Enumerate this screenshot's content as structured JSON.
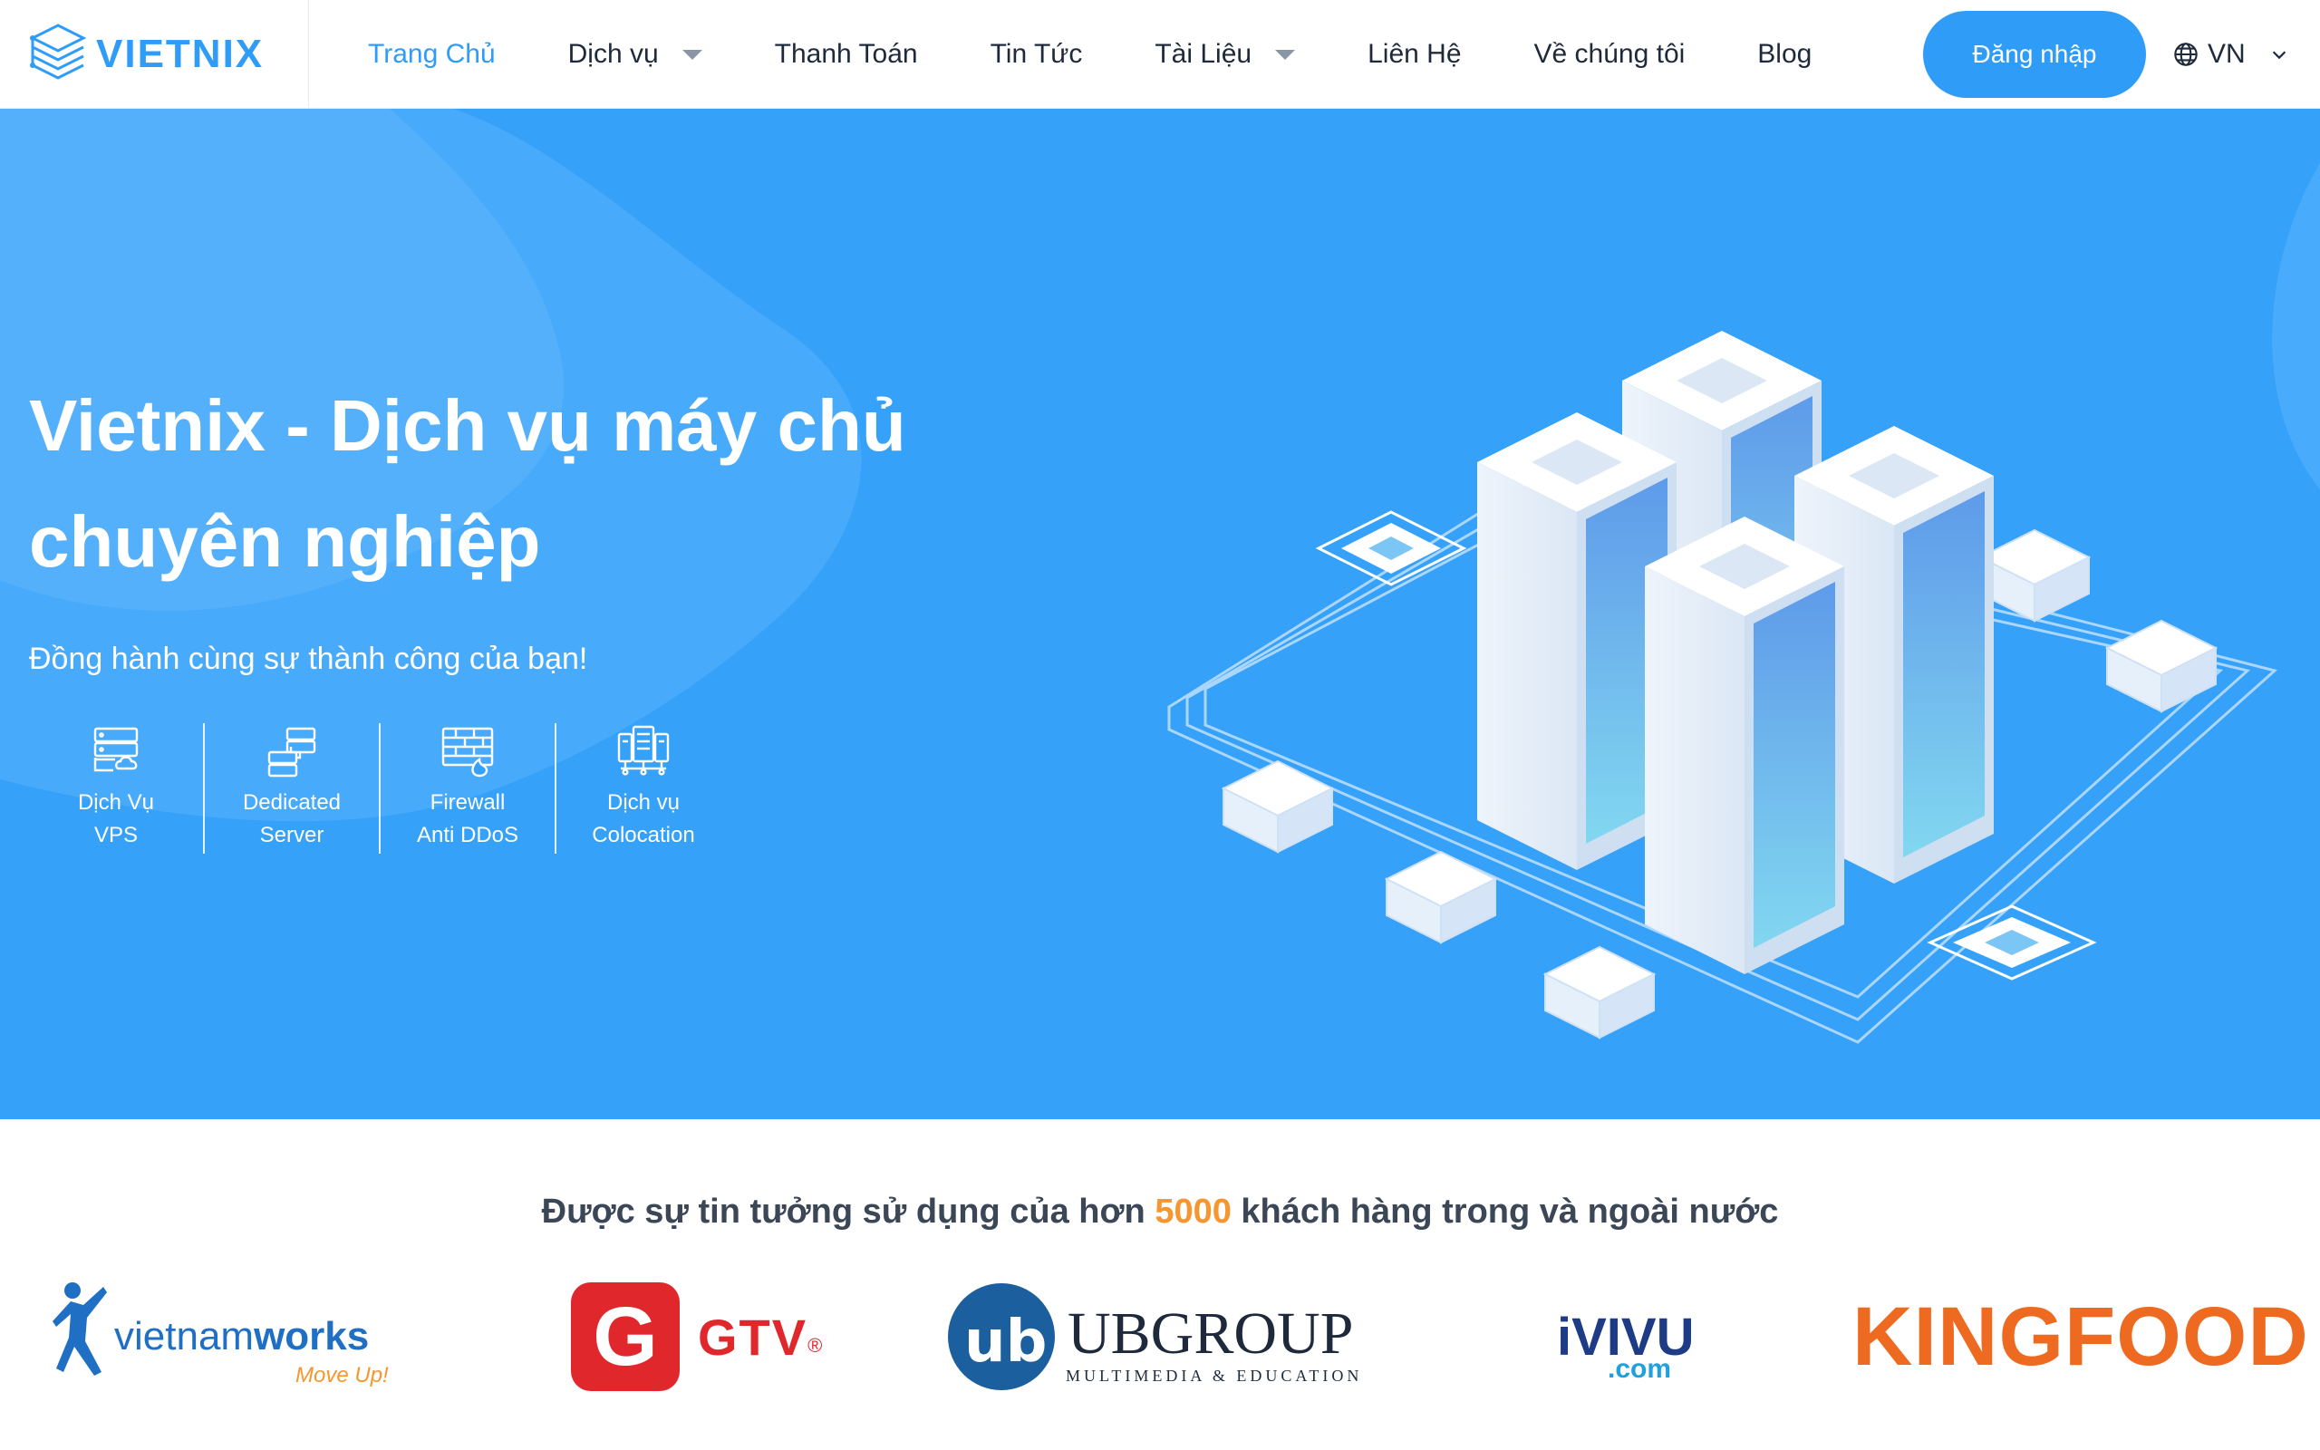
{
  "brand": {
    "name": "VIETNIX",
    "accent": "#2f9cf8"
  },
  "nav": {
    "items": [
      {
        "label": "Trang Chủ",
        "active": true,
        "dropdown": false
      },
      {
        "label": "Dịch vụ",
        "active": false,
        "dropdown": true
      },
      {
        "label": "Thanh Toán",
        "active": false,
        "dropdown": false
      },
      {
        "label": "Tin Tức",
        "active": false,
        "dropdown": false
      },
      {
        "label": "Tài Liệu",
        "active": false,
        "dropdown": true
      },
      {
        "label": "Liên Hệ",
        "active": false,
        "dropdown": false
      },
      {
        "label": "Về chúng tôi",
        "active": false,
        "dropdown": false
      },
      {
        "label": "Blog",
        "active": false,
        "dropdown": false
      }
    ],
    "login_label": "Đăng nhập",
    "language": "VN",
    "icons": {
      "language": "globe-icon",
      "language_caret": "chevron-down-icon"
    }
  },
  "hero": {
    "title_line1": "Vietnix - Dịch vụ máy chủ",
    "title_line2": "chuyên nghiệp",
    "subtitle": "Đồng hành cùng sự thành công của bạn!",
    "background_color": "#35a1f9",
    "features": [
      {
        "line1": "Dịch Vụ",
        "line2": "VPS",
        "icon": "vps-server-cloud-icon"
      },
      {
        "line1": "Dedicated",
        "line2": "Server",
        "icon": "dedicated-server-icon"
      },
      {
        "line1": "Firewall",
        "line2": "Anti DDoS",
        "icon": "firewall-icon"
      },
      {
        "line1": "Dịch vụ",
        "line2": "Colocation",
        "icon": "colocation-icon"
      }
    ],
    "illustration": "isometric-server-racks-illustration"
  },
  "clients": {
    "title_prefix": "Được sự tin tưởng sử dụng của hơn",
    "count": "5000",
    "title_suffix": "khách hàng trong và ngoài nước",
    "highlight_color": "#f7962f",
    "logos": {
      "vietnamworks": {
        "word_light": "vietnam",
        "word_bold": "works",
        "tagline": "Move Up!"
      },
      "gtv": {
        "letter": "G",
        "name": "GTV",
        "mark": "®"
      },
      "ubgroup": {
        "initials": "ub",
        "name": "UBGROUP",
        "tagline": "MULTIMEDIA & EDUCATION"
      },
      "ivivu": {
        "name": "iVIVU",
        "domain": ".com"
      },
      "kingfood": {
        "name": "KINGFOOD"
      }
    }
  }
}
